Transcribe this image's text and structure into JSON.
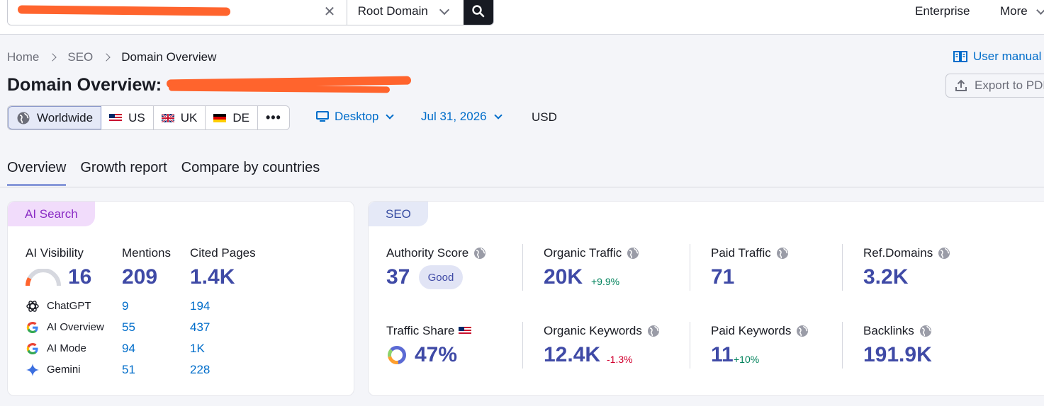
{
  "topbar": {
    "search_value": "",
    "scope": "Root Domain",
    "links": [
      "Enterprise",
      "More"
    ]
  },
  "breadcrumb": [
    "Home",
    "SEO",
    "Domain Overview"
  ],
  "page_title": "Domain Overview:",
  "header_actions": {
    "user_manual": "User manual",
    "export": "Export to PDF"
  },
  "countries": [
    {
      "label": "Worldwide",
      "icon": "globe-icon",
      "active": true
    },
    {
      "label": "US",
      "icon": "flag-us-icon"
    },
    {
      "label": "UK",
      "icon": "flag-uk-icon"
    },
    {
      "label": "DE",
      "icon": "flag-de-icon"
    },
    {
      "label": "•••",
      "icon": "more-icon"
    }
  ],
  "filters": {
    "device": "Desktop",
    "date": "Jul 31, 2026",
    "currency": "USD"
  },
  "tabs": [
    "Overview",
    "Growth report",
    "Compare by countries"
  ],
  "ai_search": {
    "tag": "AI Search",
    "headers": [
      "AI Visibility",
      "Mentions",
      "Cited Pages"
    ],
    "visibility": "16",
    "visibility_gauge": 0.16,
    "mentions": "209",
    "cited": "1.4K",
    "rows": [
      {
        "name": "ChatGPT",
        "icon": "chatgpt-icon",
        "mentions": "9",
        "cited": "194"
      },
      {
        "name": "AI Overview",
        "icon": "google-icon",
        "mentions": "55",
        "cited": "437"
      },
      {
        "name": "AI Mode",
        "icon": "google-icon",
        "mentions": "94",
        "cited": "1K"
      },
      {
        "name": "Gemini",
        "icon": "gemini-icon",
        "mentions": "51",
        "cited": "228"
      }
    ]
  },
  "seo": {
    "tag": "SEO",
    "authority": {
      "label": "Authority Score",
      "value": "37",
      "badge": "Good"
    },
    "organic_traffic": {
      "label": "Organic Traffic",
      "value": "20K",
      "delta": "+9.9%"
    },
    "paid_traffic": {
      "label": "Paid Traffic",
      "value": "71"
    },
    "ref_domains": {
      "label": "Ref.Domains",
      "value": "3.2K"
    },
    "traffic_share": {
      "label": "Traffic Share",
      "value": "47%"
    },
    "organic_keywords": {
      "label": "Organic Keywords",
      "value": "12.4K",
      "delta": "-1.3%"
    },
    "paid_keywords": {
      "label": "Paid Keywords",
      "value": "11",
      "delta": "+10%"
    },
    "backlinks": {
      "label": "Backlinks",
      "value": "191.9K"
    }
  },
  "colors": {
    "accent": "#3f4aa6",
    "link": "#006dca",
    "positive": "#00825b",
    "negative": "#d1002f",
    "redaction": "#ff642d"
  }
}
